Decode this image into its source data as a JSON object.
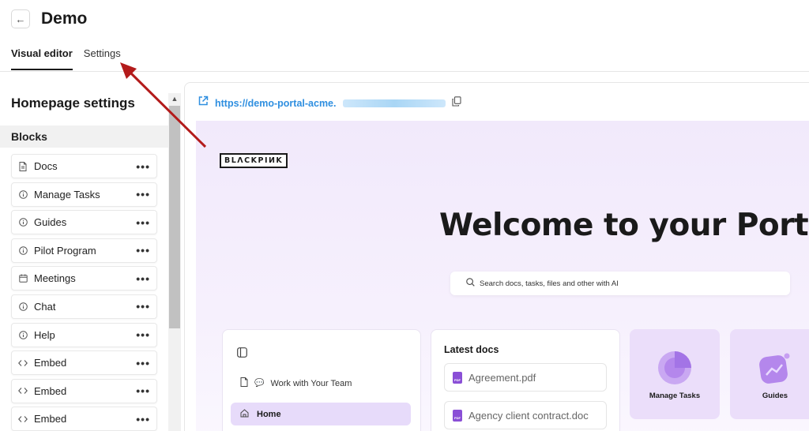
{
  "header": {
    "back_icon": "arrow-left-icon",
    "title": "Demo",
    "tabs": [
      {
        "label": "Visual editor",
        "active": true
      },
      {
        "label": "Settings",
        "active": false
      }
    ]
  },
  "sidebar": {
    "title": "Homepage settings",
    "blocks_heading": "Blocks",
    "items": [
      {
        "label": "Docs",
        "icon": "document-icon"
      },
      {
        "label": "Manage Tasks",
        "icon": "info-icon"
      },
      {
        "label": "Guides",
        "icon": "info-icon"
      },
      {
        "label": "Pilot Program",
        "icon": "info-icon"
      },
      {
        "label": "Meetings",
        "icon": "calendar-icon"
      },
      {
        "label": "Chat",
        "icon": "info-icon"
      },
      {
        "label": "Help",
        "icon": "info-icon"
      },
      {
        "label": "Embed",
        "icon": "code-icon"
      },
      {
        "label": "Embed",
        "icon": "code-icon"
      },
      {
        "label": "Embed",
        "icon": "code-icon"
      }
    ],
    "more_label": "•••"
  },
  "preview": {
    "url": "https://demo-portal-acme.",
    "logo_text": "BLΛCKPIИK",
    "welcome": "Welcome to your Portal",
    "search_placeholder": "Search docs, tasks, files and other with AI",
    "nav": {
      "item": "Work with Your Team",
      "home": "Home"
    },
    "docs": {
      "title": "Latest docs",
      "items": [
        "Agreement.pdf",
        "Agency client contract.doc"
      ]
    },
    "tiles": [
      "Manage Tasks",
      "Guides"
    ]
  },
  "colors": {
    "accent_link": "#2f8fe0",
    "hero_bg": "#f1e9fb",
    "tile_bg": "#ebdefa",
    "home_active": "#e7dbfa",
    "arrow": "#b31b1b"
  }
}
